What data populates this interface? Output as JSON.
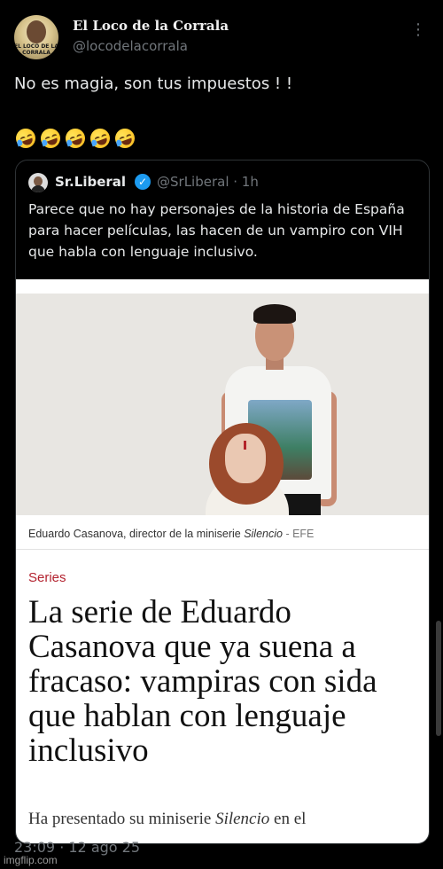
{
  "tweet": {
    "author": {
      "display_name": "El Loco de la Corrala",
      "handle": "@locodelacorrala",
      "avatar_text": "EL LOCO DE LA CORRALA"
    },
    "more_label": "⋮",
    "text": "No es magia, son tus impuestos ! !",
    "emojis": [
      "rolling-on-floor-laughing",
      "rolling-on-floor-laughing",
      "rolling-on-floor-laughing",
      "rolling-on-floor-laughing",
      "rolling-on-floor-laughing"
    ],
    "timestamp": "23:09 · 12 ago 25"
  },
  "quoted_tweet": {
    "author": {
      "display_name": "Sr.Liberal",
      "verified_glyph": "✓",
      "handle_time": "@SrLiberal · 1h"
    },
    "text": "Parece que no hay personajes de la historia de España para hacer películas, las hacen de un vampiro con VIH que habla con lenguaje inclusivo."
  },
  "article": {
    "caption_main": "Eduardo Casanova, director de la miniserie ",
    "caption_italic": "Silencio",
    "caption_source": " - EFE",
    "section": "Series",
    "headline": "La serie de Eduardo Casanova que ya suena a fracaso: vampiras con sida que hablan con lenguaje inclusivo",
    "lead_start": "Ha presentado su miniserie ",
    "lead_italic": "Silencio",
    "lead_end": " en el"
  },
  "watermark": "imgflip.com",
  "colors": {
    "background": "#000000",
    "text": "#e7e9ea",
    "muted": "#71767b",
    "verified": "#1d9bf0",
    "section_red": "#b3222f"
  }
}
